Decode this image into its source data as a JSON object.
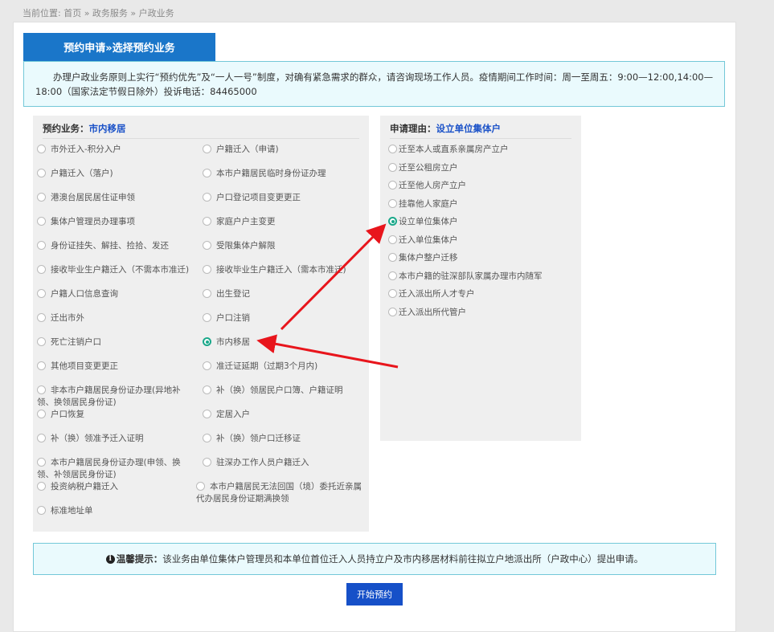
{
  "breadcrumb": "当前位置: 首页 » 政务服务 » 户政业务",
  "tab_title": "预约申请»选择预约业务",
  "notice": "办理户政业务原则上实行“预约优先”及“一人一号”制度，对确有紧急需求的群众，请咨询现场工作人员。疫情期间工作时间：周一至周五：9:00—12:00,14:00—18:00（国家法定节假日除外）投诉电话：84465000",
  "business": {
    "label": "预约业务：",
    "selected": "市内移居",
    "options": [
      {
        "label": "市外迁入-积分入户"
      },
      {
        "label": "户籍迁入（申请)"
      },
      {
        "label": "户籍迁入（落户)"
      },
      {
        "label": "本市户籍居民临时身份证办理"
      },
      {
        "label": "港澳台居民居住证申领"
      },
      {
        "label": "户口登记项目变更更正"
      },
      {
        "label": "集体户管理员办理事项"
      },
      {
        "label": "家庭户户主变更"
      },
      {
        "label": "身份证挂失、解挂、捡拾、发还"
      },
      {
        "label": "受限集体户解限"
      },
      {
        "label": "接收毕业生户籍迁入（不需本市准迁)"
      },
      {
        "label": "接收毕业生户籍迁入（需本市准迁)"
      },
      {
        "label": "户籍人口信息查询"
      },
      {
        "label": "出生登记"
      },
      {
        "label": "迁出市外"
      },
      {
        "label": "户口注销"
      },
      {
        "label": "死亡注销户口"
      },
      {
        "label": "市内移居",
        "selected": true
      },
      {
        "label": "其他项目变更更正"
      },
      {
        "label": "准迁证延期（过期3个月内)"
      },
      {
        "label": "非本市户籍居民身份证办理(异地补领、换领居民身份证)"
      },
      {
        "label": "补（换）领居民户口簿、户籍证明"
      },
      {
        "label": "户口恢复"
      },
      {
        "label": "定居入户"
      },
      {
        "label": "补（换）领准予迁入证明"
      },
      {
        "label": "补（换）领户口迁移证"
      },
      {
        "label": "本市户籍居民身份证办理(申领、换领、补领居民身份证)"
      },
      {
        "label": "驻深办工作人员户籍迁入"
      },
      {
        "label": "投资纳税户籍迁入"
      },
      {
        "label": "本市户籍居民无法回国（境）委托近亲属代办居民身份证期满换领"
      },
      {
        "label": "标准地址单"
      }
    ]
  },
  "reason": {
    "label": "申请理由：",
    "selected": "设立单位集体户",
    "options": [
      {
        "label": "迁至本人或直系亲属房产立户"
      },
      {
        "label": "迁至公租房立户"
      },
      {
        "label": "迁至他人房产立户"
      },
      {
        "label": "挂靠他人家庭户"
      },
      {
        "label": "设立单位集体户",
        "selected": true
      },
      {
        "label": "迁入单位集体户"
      },
      {
        "label": "集体户整户迁移"
      },
      {
        "label": "本市户籍的驻深部队家属办理市内随军"
      },
      {
        "label": "迁入派出所人才专户"
      },
      {
        "label": "迁入派出所代管户"
      }
    ]
  },
  "tip": {
    "title": "温馨提示：",
    "text": "该业务由单位集体户管理员和本单位首位迁入人员持立户及市内移居材料前往拟立户地派出所（户政中心）提出申请。"
  },
  "start_button": "开始预约",
  "colors": {
    "accent": "#1a76c9",
    "button": "#1650c8",
    "selected_radio": "#1aa88a",
    "arrow": "#e8151c"
  }
}
